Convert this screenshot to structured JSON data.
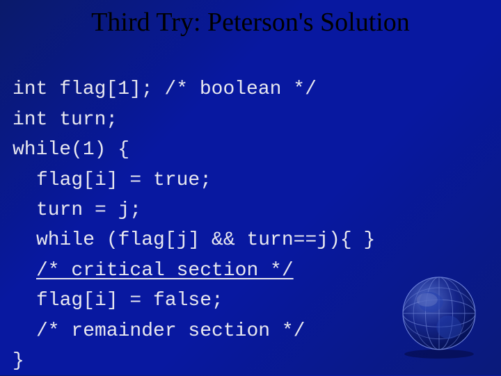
{
  "title": "Third Try: Peterson's Solution",
  "code": {
    "line1": "int flag[1]; /* boolean */",
    "line2": "int turn;",
    "line3": "while(1) {",
    "line4": "flag[i] = true;",
    "line5": "turn = j;",
    "line6": "while (flag[j] && turn==j){ }",
    "line7": "/* critical section */",
    "line8": "flag[i] = false;",
    "line9": "/* remainder section */",
    "line10": "}"
  },
  "decor": {
    "globe_icon": "globe-icon"
  }
}
